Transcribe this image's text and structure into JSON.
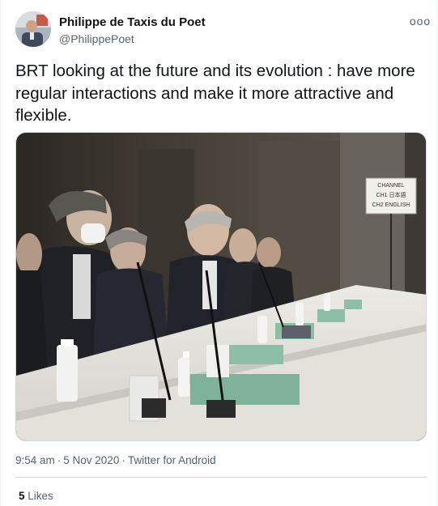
{
  "author": {
    "display_name": "Philippe de Taxis du Poet",
    "handle": "@PhilippePoet",
    "more_glyph": "ooo"
  },
  "tweet": {
    "text": "BRT looking at the future and its evolution : have more regular interactions and make it more attractive and flexible.",
    "time": "9:54 am",
    "date": "5 Nov 2020",
    "separator": "·",
    "source": "Twitter for Android"
  },
  "media": {
    "sign_lines": [
      "CHANNEL",
      "CH1  日本語",
      "CH2  ENGLISH"
    ]
  },
  "stats": {
    "likes_count": "5",
    "likes_label": "Likes"
  }
}
